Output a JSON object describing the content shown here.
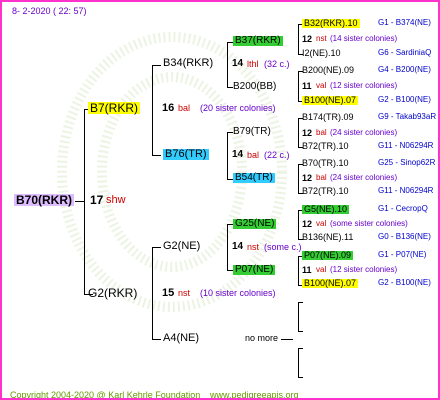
{
  "header": {
    "timestamp": "8-  2-2020 ( 22: 57)"
  },
  "footer": {
    "copyright": "Copyright 2004-2020 @ Karl Kehrle Foundation",
    "website": "www.pedigreeapis.org"
  },
  "colors": {
    "frame": "#ff33cc",
    "subject_bg": "#ddbbff",
    "yellow": "#ffff00",
    "green": "#33cc33",
    "cyan": "#33ccff",
    "gen_label": "#cc0000",
    "info": "#6600cc",
    "blue": "#0000cc"
  },
  "tree": {
    "subject": {
      "name": "B70(RKR)",
      "gen": "17",
      "place": "shw"
    },
    "father": {
      "name": "B7(RKR)",
      "gen": "16",
      "place": "bal",
      "note": "(20 sister colonies)"
    },
    "mother": {
      "name": "G2(RKR)",
      "gen": "15",
      "place": "nst",
      "note": "(10 sister colonies)"
    },
    "ff": {
      "name": "B34(RKR)",
      "gen": "14",
      "place": "lthl",
      "note": "(32 c.)"
    },
    "fm": {
      "name": "B76(TR)",
      "gen": "14",
      "place": "bal",
      "note": "(22 c.)"
    },
    "mf": {
      "name": "G2(NE)",
      "gen": "14",
      "place": "nst",
      "note": "(some c.)"
    },
    "mm": {
      "name": "A4(NE)",
      "note": "no more"
    },
    "fff": "B37(RKR)",
    "ffm": "B200(BB)",
    "fmf": "B79(TR)",
    "fmm": "B54(TR)",
    "mff": "G25(NE)",
    "mfm": "P07(NE)"
  },
  "rows": [
    {
      "name": "B32(RKR).10",
      "code": "G1 - B374(NE)"
    },
    {
      "num": "12",
      "place": "nst",
      "note": "(14 sister colonies)"
    },
    {
      "name": "I2(NE).10",
      "code": "G6 - SardiniaQ"
    },
    {
      "name": "B200(NE).09",
      "code": "G4 - B200(NE)"
    },
    {
      "num": "11",
      "place": "val",
      "note": "(12 sister colonies)"
    },
    {
      "name": "B100(NE).07",
      "code": "G2 - B100(NE)"
    },
    {
      "name": "B174(TR).09",
      "code": "G9 - Takab93aR"
    },
    {
      "num": "12",
      "place": "bal",
      "note": "(24 sister colonies)"
    },
    {
      "name": "B72(TR).10",
      "code": "G11 - N06294R"
    },
    {
      "name": "B70(TR).10",
      "code": "G25 - Sinop62R"
    },
    {
      "num": "12",
      "place": "bal",
      "note": "(24 sister colonies)"
    },
    {
      "name": "B72(TR).10",
      "code": "G11 - N06294R"
    },
    {
      "name": "G5(NE).10",
      "code": "G1 - CecropQ"
    },
    {
      "num": "12",
      "place": "val",
      "note": "(some sister colonies)"
    },
    {
      "name": "B136(NE).11",
      "code": "G0 - B136(NE)"
    },
    {
      "name": "P07(NE).09",
      "code": "G1 - P07(NE)"
    },
    {
      "num": "11",
      "place": "val",
      "note": "(12 sister colonies)"
    },
    {
      "name": "B100(NE).07",
      "code": "G2 - B100(NE)"
    }
  ]
}
